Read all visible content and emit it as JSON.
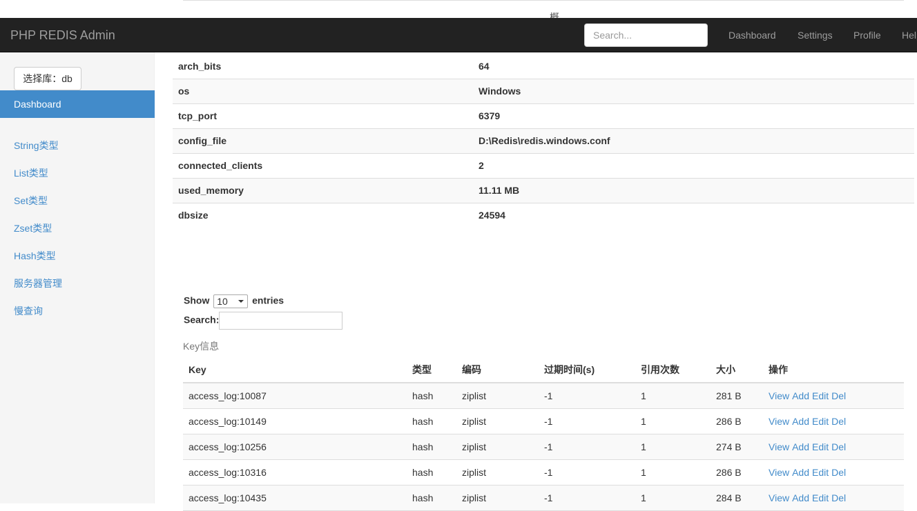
{
  "navbar": {
    "brand": "PHP REDIS Admin",
    "search_placeholder": "Search...",
    "links": [
      "Dashboard",
      "Settings",
      "Profile",
      "Help"
    ]
  },
  "sidebar": {
    "db_button": "选择库：db",
    "active_item": "Dashboard",
    "items": [
      "String类型",
      "List类型",
      "Set类型",
      "Zset类型",
      "Hash类型",
      "服务器管理",
      "慢查询"
    ]
  },
  "server_info": [
    {
      "key": "arch_bits",
      "value": "64"
    },
    {
      "key": "os",
      "value": "Windows"
    },
    {
      "key": "tcp_port",
      "value": "6379"
    },
    {
      "key": "config_file",
      "value": "D:\\Redis\\redis.windows.conf"
    },
    {
      "key": "connected_clients",
      "value": "2"
    },
    {
      "key": "used_memory",
      "value": "11.11 MB"
    },
    {
      "key": "dbsize",
      "value": "24594"
    }
  ],
  "datatable": {
    "show_label": "Show",
    "entries_value": "10",
    "entries_label": "entries",
    "search_label": "Search:",
    "caption": "Key信息",
    "columns": [
      "Key",
      "类型",
      "编码",
      "过期时间(s)",
      "引用次数",
      "大小",
      "操作"
    ],
    "actions": [
      "View",
      "Add",
      "Edit",
      "Del"
    ],
    "rows": [
      {
        "key": "access_log:10087",
        "type": "hash",
        "encoding": "ziplist",
        "ttl": "-1",
        "refcount": "1",
        "size": "281 B"
      },
      {
        "key": "access_log:10149",
        "type": "hash",
        "encoding": "ziplist",
        "ttl": "-1",
        "refcount": "1",
        "size": "286 B"
      },
      {
        "key": "access_log:10256",
        "type": "hash",
        "encoding": "ziplist",
        "ttl": "-1",
        "refcount": "1",
        "size": "274 B"
      },
      {
        "key": "access_log:10316",
        "type": "hash",
        "encoding": "ziplist",
        "ttl": "-1",
        "refcount": "1",
        "size": "286 B"
      },
      {
        "key": "access_log:10435",
        "type": "hash",
        "encoding": "ziplist",
        "ttl": "-1",
        "refcount": "1",
        "size": "284 B"
      }
    ]
  }
}
